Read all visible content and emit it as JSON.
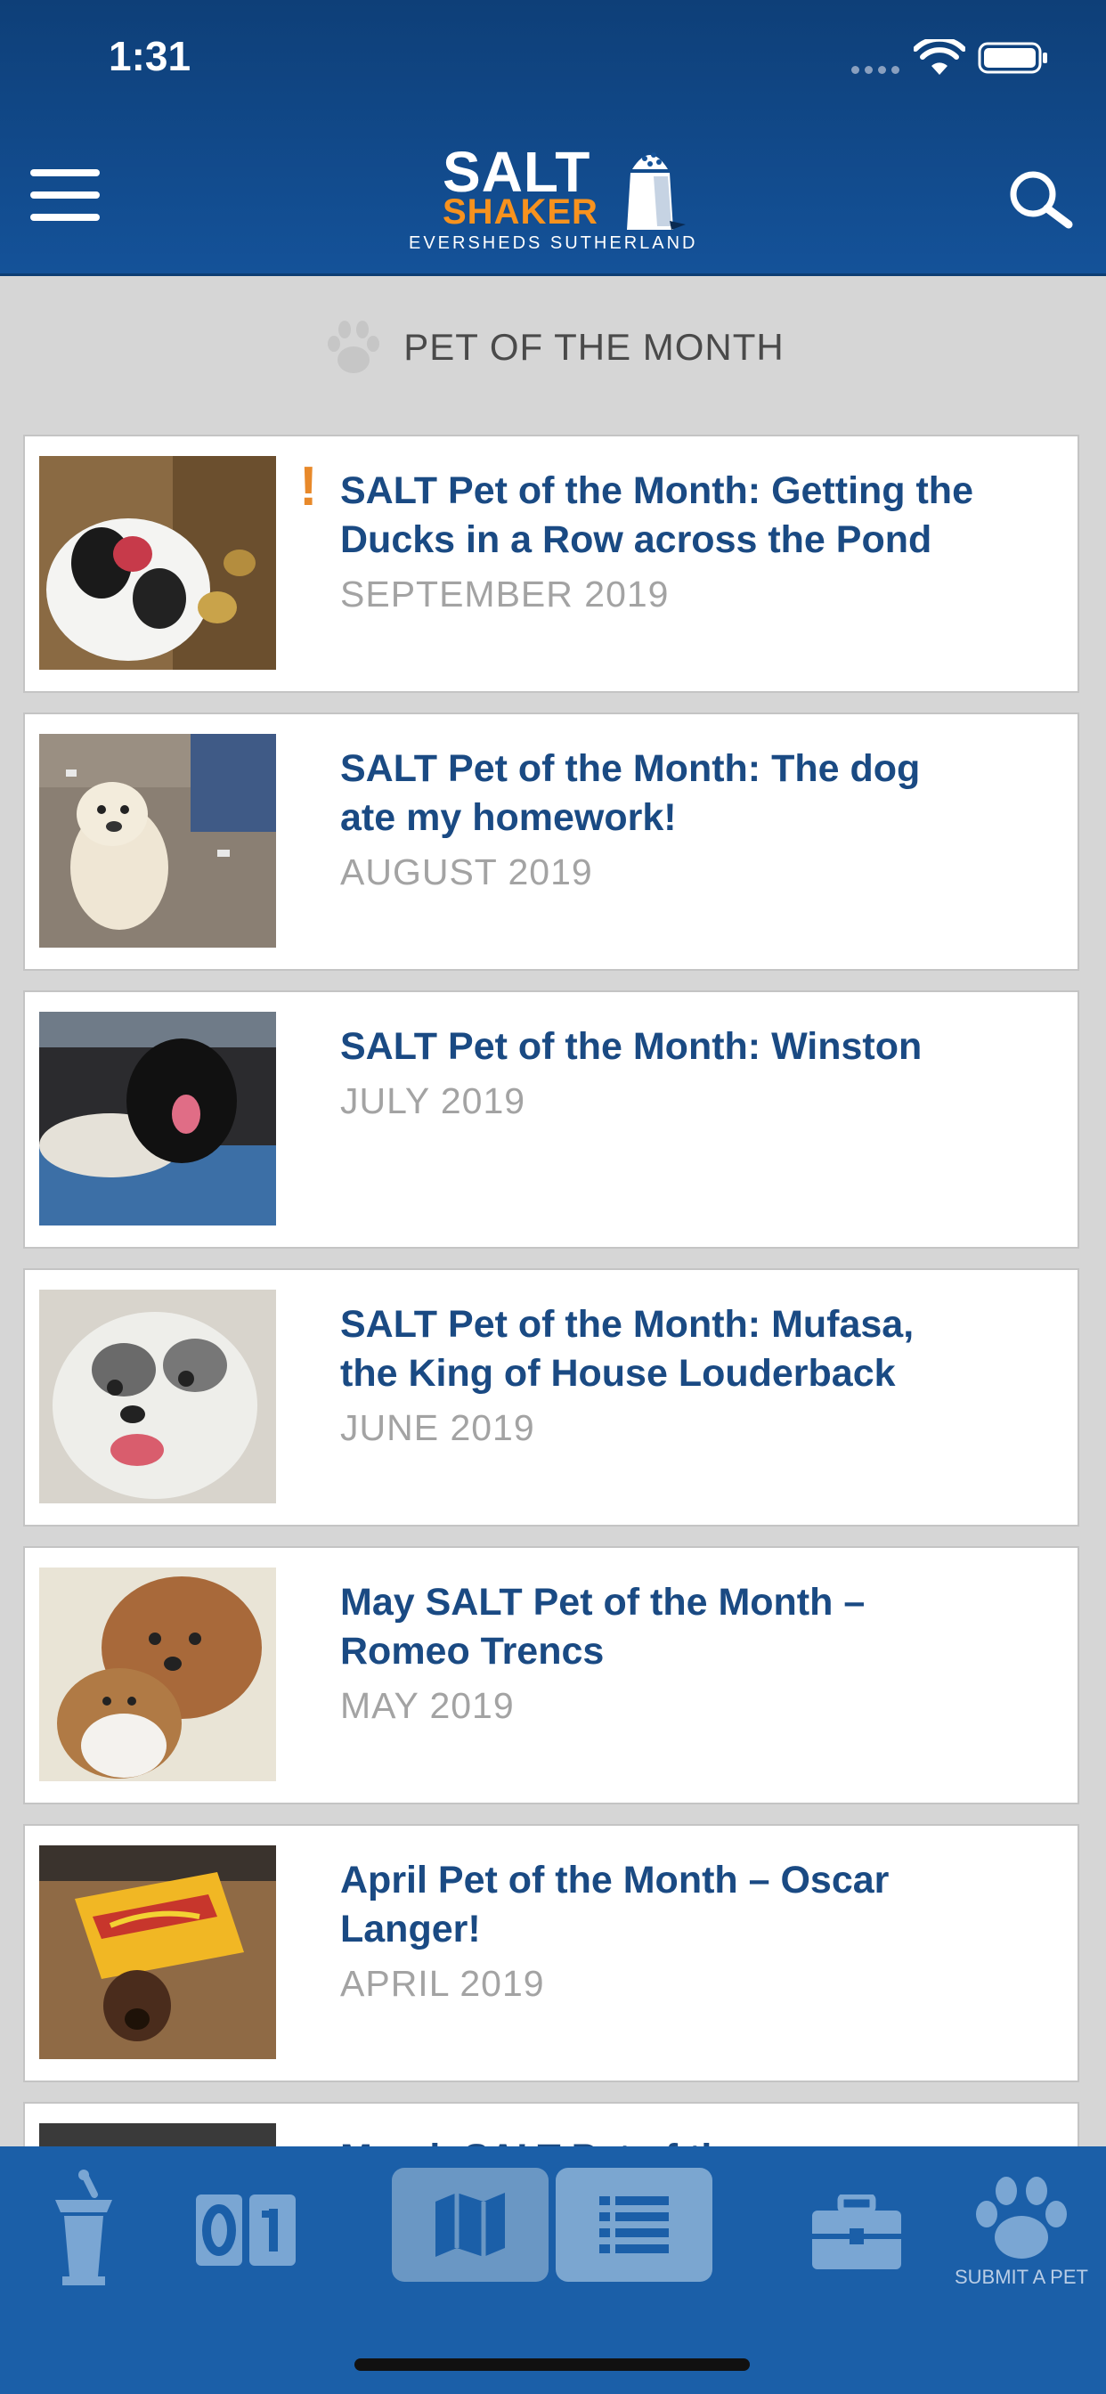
{
  "status_bar": {
    "time": "1:31"
  },
  "header": {
    "logo": {
      "line1": "SALT",
      "line2": "SHAKER",
      "sub": "EVERSHEDS SUTHERLAND"
    },
    "menu_icon": "hamburger-menu-icon",
    "search_icon": "search-icon"
  },
  "section": {
    "title": "PET OF THE MONTH",
    "icon": "paw-icon"
  },
  "articles": [
    {
      "title": "SALT Pet of the Month: Getting the Ducks in a Row across the Pond",
      "date": "SEPTEMBER 2019",
      "alert": "!"
    },
    {
      "title": "SALT Pet of the Month: The dog ate my homework!",
      "date": "AUGUST 2019"
    },
    {
      "title": "SALT Pet of the Month: Winston",
      "date": "JULY 2019"
    },
    {
      "title": "SALT Pet of the Month: Mufasa, the King of House Louderback",
      "date": "JUNE 2019"
    },
    {
      "title": "May SALT Pet of the Month – Romeo Trencs",
      "date": "MAY 2019"
    },
    {
      "title": "April Pet of the Month – Oscar Langer!",
      "date": "APRIL 2019"
    },
    {
      "title": "March SALT Pet of the",
      "date": ""
    }
  ],
  "tabbar": {
    "submit_label": "SUBMIT A PET",
    "episodes_label": "01"
  },
  "colors": {
    "header_blue": "#145299",
    "tabbar_blue": "#1b5fa8",
    "title_blue": "#1a4a83",
    "accent_orange": "#f7921e",
    "date_gray": "#a3a3a3"
  }
}
